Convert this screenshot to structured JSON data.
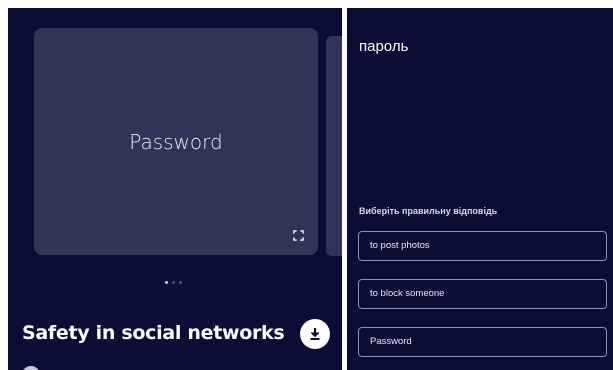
{
  "flashcard": {
    "term": "Password",
    "dots": [
      true,
      false,
      false
    ]
  },
  "set": {
    "title": "Safety in social networks"
  },
  "icons": {
    "expand": "fullscreen-expand-icon",
    "download": "download-icon",
    "avatar": "avatar"
  },
  "quiz": {
    "term": "пароль",
    "prompt": "Виберіть правильну відповідь",
    "options": [
      {
        "label": "to post photos"
      },
      {
        "label": "to block someone"
      },
      {
        "label": "Password"
      }
    ]
  },
  "colors": {
    "background": "#0b0d36",
    "card": "#2e3559",
    "option_border": "#8f93ac"
  }
}
